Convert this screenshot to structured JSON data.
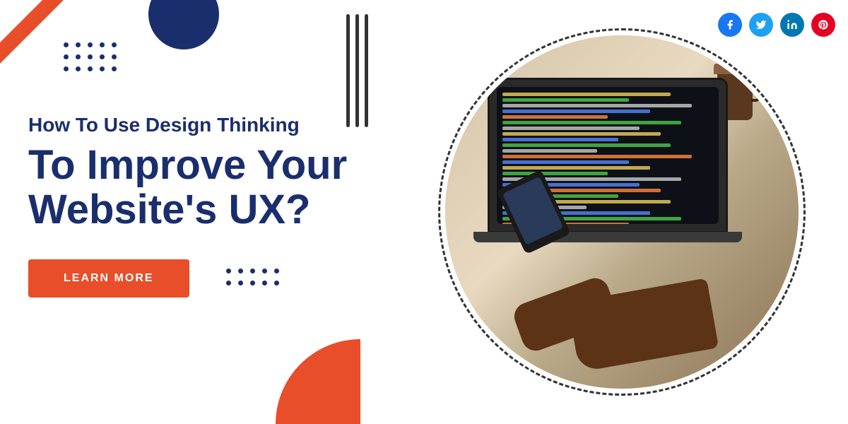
{
  "page": {
    "background": "#ffffff"
  },
  "social": {
    "icons": [
      {
        "name": "facebook",
        "label": "f",
        "color": "facebook"
      },
      {
        "name": "twitter",
        "label": "t",
        "color": "twitter"
      },
      {
        "name": "linkedin",
        "label": "in",
        "color": "linkedin"
      },
      {
        "name": "pinterest",
        "label": "p",
        "color": "pinterest"
      }
    ]
  },
  "hero": {
    "subtitle": "How To Use Design Thinking",
    "line1": "To Improve Your",
    "line2": "Website's UX?",
    "cta_label": "LEARN MORE"
  },
  "decorations": {
    "dot_count": 15
  }
}
